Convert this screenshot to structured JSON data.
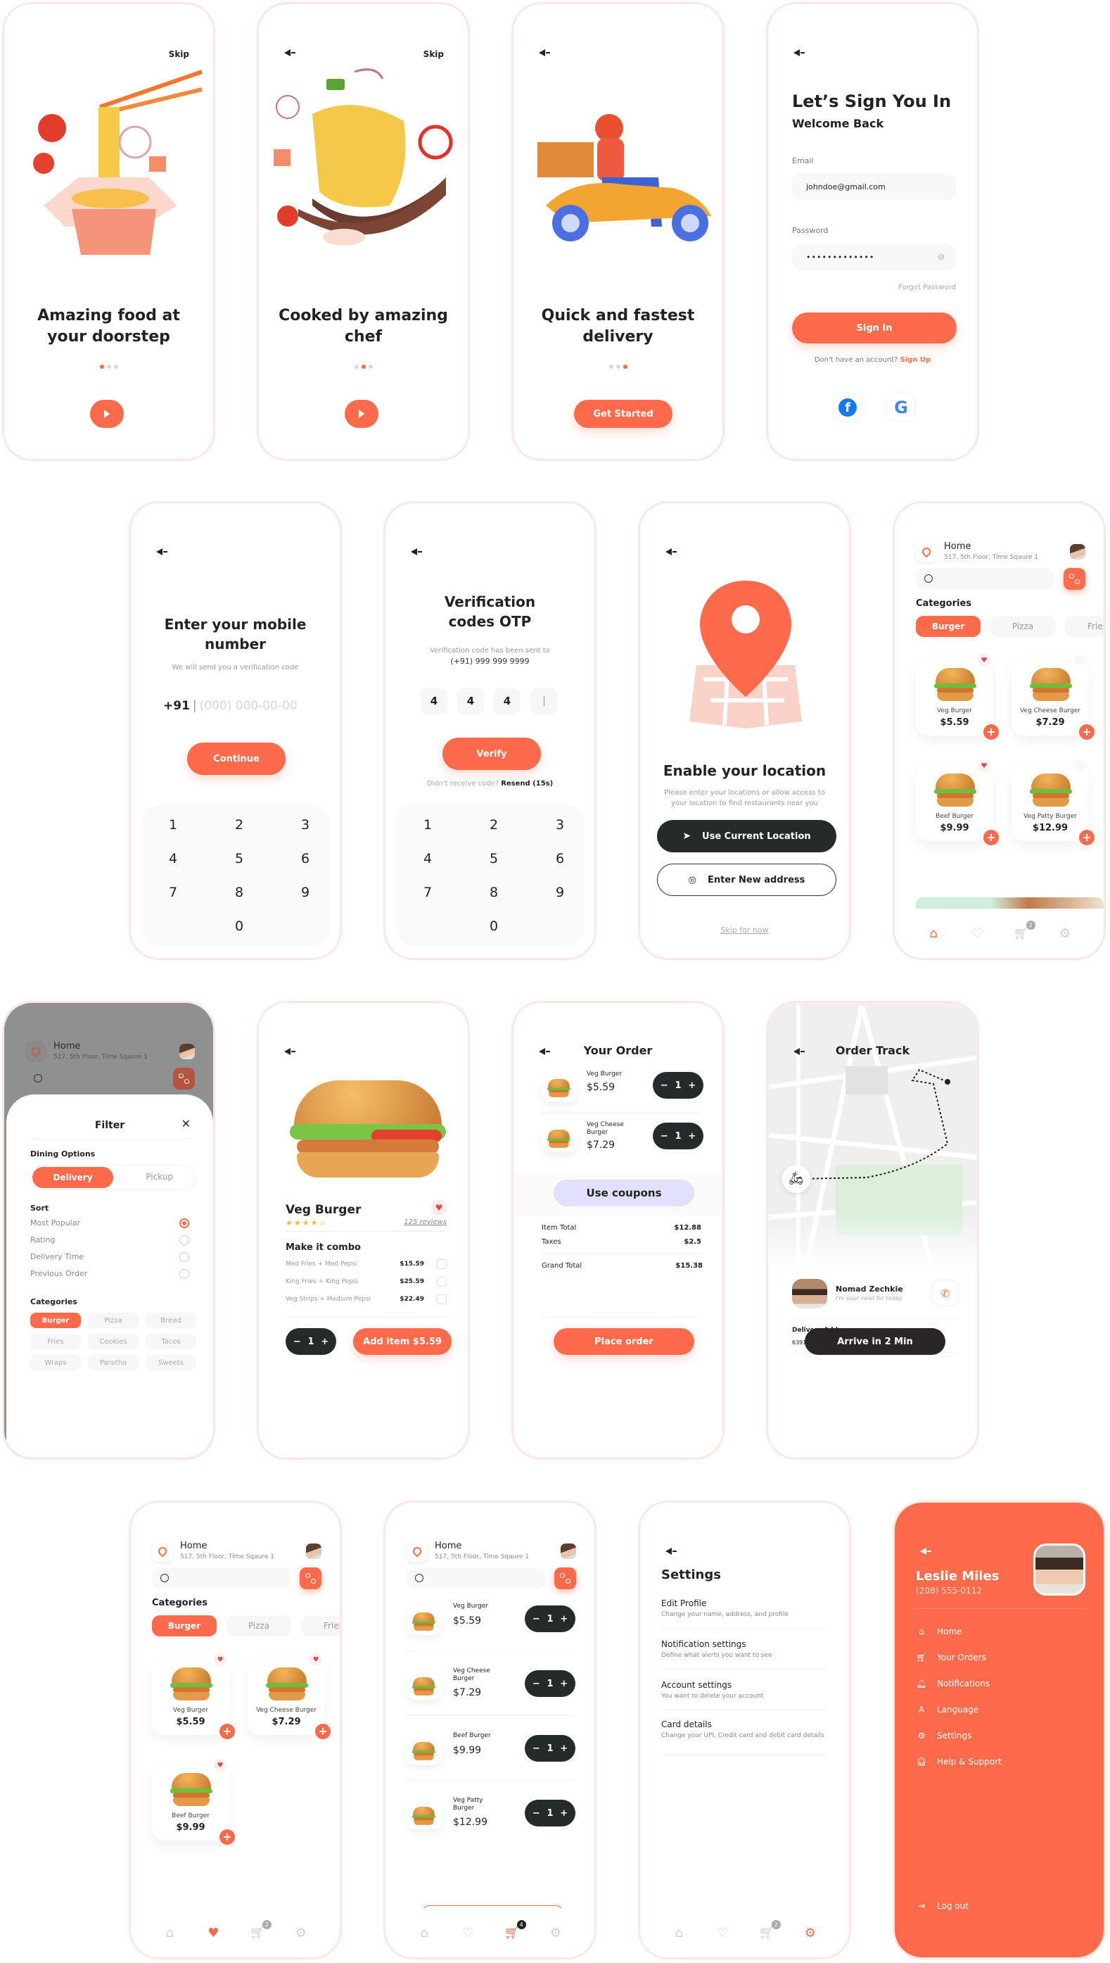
{
  "theme": {
    "accent": "#ff6b4a",
    "dark": "#252b2a",
    "coupon_bg": "#e2e0ff",
    "frame_border": "#fde7e2"
  },
  "onboarding": [
    {
      "skip_label": "Skip",
      "title": "Amazing food at your doorstep",
      "active_dot": 0,
      "button_icon": "arrow-right-icon",
      "illustration": "noodle-box-illustration"
    },
    {
      "skip_label": "Skip",
      "title": "Cooked by amazing chef",
      "active_dot": 1,
      "button_icon": "arrow-right-icon",
      "illustration": "wok-noodles-illustration"
    },
    {
      "title": "Quick and fastest delivery",
      "active_dot": 2,
      "button_label": "Get Started",
      "illustration": "scooter-delivery-illustration"
    }
  ],
  "signin": {
    "title": "Let’s Sign You In",
    "subtitle": "Welcome Back",
    "email_label": "Email",
    "email_value": "johndoe@gmail.com",
    "password_label": "Password",
    "password_value": "•••••••••••••",
    "forgot_label": "Forget Password",
    "signin_button": "Sign In",
    "no_account_text": "Don't have an account?",
    "signup_link": "Sign Up",
    "social": [
      "facebook-icon",
      "google-icon"
    ]
  },
  "mobile": {
    "title": "Enter your mobile number",
    "subtitle": "We will send you a verification code",
    "country_code": "+91",
    "phone_placeholder": "(000) 000-00-00",
    "continue_button": "Continue",
    "keys": [
      "1",
      "2",
      "3",
      "4",
      "5",
      "6",
      "7",
      "8",
      "9",
      "0"
    ]
  },
  "otp": {
    "title": "Verification codes OTP",
    "subtitle": "Verification code has been sent to",
    "phone": "(+91) 999 999 9999",
    "digits": [
      "4",
      "4",
      "4",
      ""
    ],
    "verify_button": "Verify",
    "resend_prompt": "Didn't receive code?",
    "resend_link": "Resend (15s)",
    "keys": [
      "1",
      "2",
      "3",
      "4",
      "5",
      "6",
      "7",
      "8",
      "9",
      "0"
    ]
  },
  "location": {
    "title": "Enable your location",
    "description": "Please enter your locations or allow access to your location to find restaurants near you",
    "use_current_button": "Use Current Location",
    "new_address_button": "Enter New address",
    "skip_link": "Skip for now"
  },
  "home_header": {
    "title": "Home",
    "address": "517, 5th Floor, Time Sqaure 1",
    "categories_title": "Categories"
  },
  "categories": [
    "Burger",
    "Pizza",
    "Fries"
  ],
  "menu_items": [
    {
      "name": "Veg Burger",
      "price": "$5.59",
      "favorite": true
    },
    {
      "name": "Veg Cheese Burger",
      "price": "$7.29",
      "favorite": false
    },
    {
      "name": "Beef Burger",
      "price": "$9.99",
      "favorite": true
    },
    {
      "name": "Veg Patty Burger",
      "price": "$12.99",
      "favorite": false
    }
  ],
  "favorites_items": [
    {
      "name": "Veg Burger",
      "price": "$5.59",
      "favorite": true
    },
    {
      "name": "Veg Cheese Burger",
      "price": "$7.29",
      "favorite": true
    },
    {
      "name": "Beef Burger",
      "price": "$9.99",
      "favorite": true
    }
  ],
  "tabbar": {
    "tabs": [
      "home-icon",
      "heart-icon",
      "cart-icon",
      "gear-icon"
    ],
    "cart_badge_home": "2",
    "cart_badge_cart": "4"
  },
  "filter": {
    "title": "Filter",
    "dining_title": "Dining Options",
    "dining_options": [
      "Delivery",
      "Pickup"
    ],
    "dining_selected": "Delivery",
    "sort_title": "Sort",
    "sort_options": [
      "Most Popular",
      "Rating",
      "Delivery Time",
      "Previous Order"
    ],
    "sort_selected": "Most Popular",
    "categories_title": "Categories",
    "categories": [
      "Burger",
      "Pizza",
      "Bread",
      "Fries",
      "Cookies",
      "Tacos",
      "Wraps",
      "Paratha",
      "Sweets"
    ],
    "category_selected": "Burger"
  },
  "product": {
    "name": "Veg Burger",
    "rating": 4,
    "rating_max": 5,
    "reviews": "125 reviews",
    "combo_title": "Make it combo",
    "combos": [
      {
        "name": "Med Fries + Med Pepsi",
        "price": "$15.59"
      },
      {
        "name": "King Fries + King Pepsi",
        "price": "$25.59"
      },
      {
        "name": "Veg Strips + Medium Pepsi",
        "price": "$22.49"
      }
    ],
    "quantity": "1",
    "add_button": "Add item $5.59"
  },
  "order": {
    "title": "Your Order",
    "items": [
      {
        "name": "Veg Burger",
        "price": "$5.59",
        "qty": "1"
      },
      {
        "name": "Veg  Cheese Burger",
        "price": "$7.29",
        "qty": "1"
      }
    ],
    "coupon_button": "Use coupons",
    "item_total_label": "Item Total",
    "item_total": "$12.88",
    "taxes_label": "Taxes",
    "taxes": "$2.5",
    "grand_total_label": "Grand Total",
    "grand_total": "$15.38",
    "place_button": "Place order"
  },
  "track": {
    "title": "Order Track",
    "driver_name": "Nomad Zechkie",
    "driver_note": "I'm your valet for today",
    "address_label": "Delivery Address",
    "address": "6391 Elgin St. Celina, Delaware 10299",
    "arrive_button": "Arrive in 2 Min"
  },
  "cart": {
    "items": [
      {
        "name": "Veg Burger",
        "price": "$5.59",
        "qty": "1"
      },
      {
        "name": "Veg  Cheese Burger",
        "price": "$7.29",
        "qty": "1"
      },
      {
        "name": "Beef Burger",
        "price": "$9.99",
        "qty": "1"
      },
      {
        "name": "Veg  Patty Burger",
        "price": "$12.99",
        "qty": "1"
      }
    ]
  },
  "settings": {
    "title": "Settings",
    "items": [
      {
        "title": "Edit Profile",
        "subtitle": "Change your name, address, and profile"
      },
      {
        "title": "Notification settings",
        "subtitle": "Define what alerts you want to see"
      },
      {
        "title": "Account settings",
        "subtitle": "You want to delete your account"
      },
      {
        "title": "Card details",
        "subtitle": "Change your UPI, Credit card and debit card details"
      }
    ]
  },
  "drawer": {
    "name": "Leslie Miles",
    "phone": "(208) 555-0112",
    "items": [
      {
        "label": "Home",
        "icon": "home-icon"
      },
      {
        "label": "Your Orders",
        "icon": "cart-icon"
      },
      {
        "label": "Notifications",
        "icon": "bell-icon"
      },
      {
        "label": "Language",
        "icon": "language-icon"
      },
      {
        "label": "Settings",
        "icon": "gear-icon"
      },
      {
        "label": "Help & Support",
        "icon": "headphones-icon"
      }
    ],
    "logout": "Log out"
  }
}
